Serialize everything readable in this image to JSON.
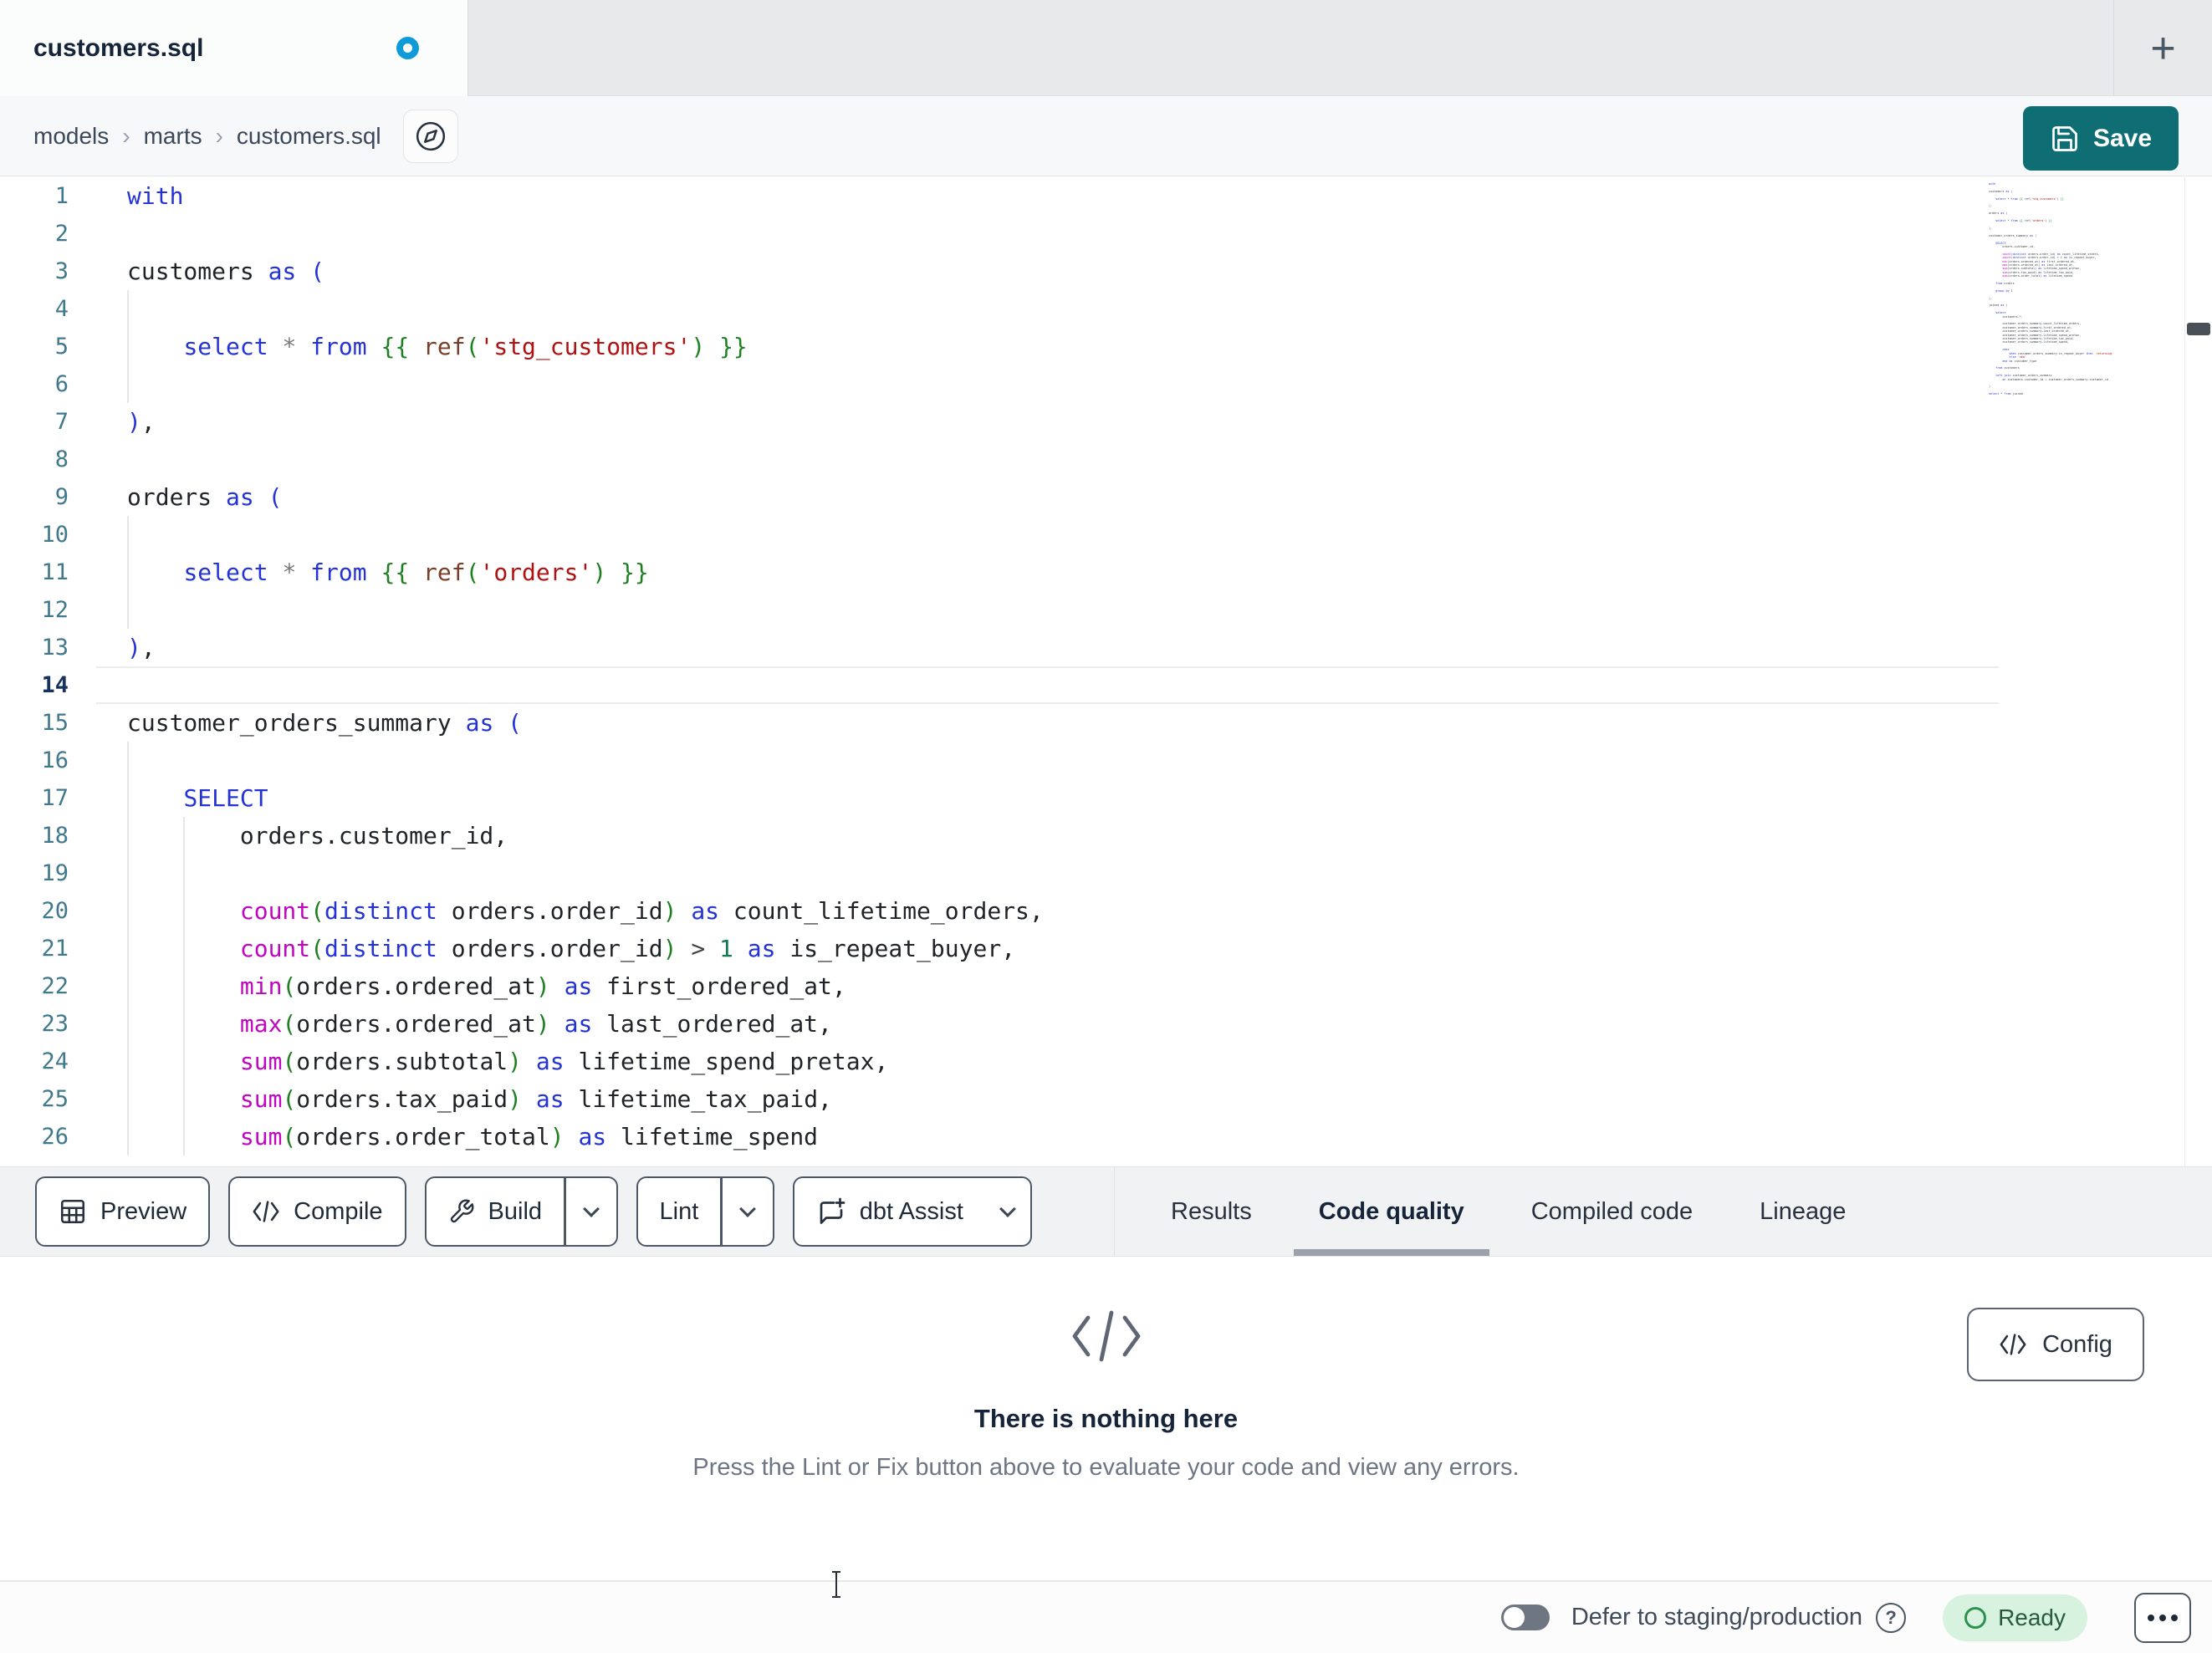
{
  "tab_bar": {
    "active_tab": "customers.sql",
    "new_tab_label": "+"
  },
  "breadcrumb": {
    "items": [
      "models",
      "marts",
      "customers.sql"
    ],
    "separator": "›"
  },
  "save": {
    "label": "Save"
  },
  "editor": {
    "active_line": 14,
    "lines": [
      {
        "n": 1,
        "tokens": [
          [
            "kw",
            "with"
          ]
        ]
      },
      {
        "n": 2,
        "tokens": []
      },
      {
        "n": 3,
        "tokens": [
          [
            "id",
            "customers"
          ],
          [
            "ws",
            " "
          ],
          [
            "kw",
            "as"
          ],
          [
            "ws",
            " "
          ],
          [
            "pb",
            "("
          ]
        ]
      },
      {
        "n": 4,
        "tokens": []
      },
      {
        "n": 5,
        "tokens": [
          [
            "ws",
            "    "
          ],
          [
            "kw",
            "select"
          ],
          [
            "ws",
            " "
          ],
          [
            "gray",
            "*"
          ],
          [
            "ws",
            " "
          ],
          [
            "kw",
            "from"
          ],
          [
            "ws",
            " "
          ],
          [
            "br",
            "{{"
          ],
          [
            "ws",
            " "
          ],
          [
            "ref",
            "ref"
          ],
          [
            "pg",
            "("
          ],
          [
            "str",
            "'stg_customers'"
          ],
          [
            "pg",
            ")"
          ],
          [
            "ws",
            " "
          ],
          [
            "br",
            "}}"
          ]
        ]
      },
      {
        "n": 6,
        "tokens": []
      },
      {
        "n": 7,
        "tokens": [
          [
            "pb",
            ")"
          ],
          [
            "id",
            ","
          ]
        ]
      },
      {
        "n": 8,
        "tokens": []
      },
      {
        "n": 9,
        "tokens": [
          [
            "id",
            "orders"
          ],
          [
            "ws",
            " "
          ],
          [
            "kw",
            "as"
          ],
          [
            "ws",
            " "
          ],
          [
            "pb",
            "("
          ]
        ]
      },
      {
        "n": 10,
        "tokens": []
      },
      {
        "n": 11,
        "tokens": [
          [
            "ws",
            "    "
          ],
          [
            "kw",
            "select"
          ],
          [
            "ws",
            " "
          ],
          [
            "gray",
            "*"
          ],
          [
            "ws",
            " "
          ],
          [
            "kw",
            "from"
          ],
          [
            "ws",
            " "
          ],
          [
            "br",
            "{{"
          ],
          [
            "ws",
            " "
          ],
          [
            "ref",
            "ref"
          ],
          [
            "pg",
            "("
          ],
          [
            "str",
            "'orders'"
          ],
          [
            "pg",
            ")"
          ],
          [
            "ws",
            " "
          ],
          [
            "br",
            "}}"
          ]
        ]
      },
      {
        "n": 12,
        "tokens": []
      },
      {
        "n": 13,
        "tokens": [
          [
            "pb",
            ")"
          ],
          [
            "id",
            ","
          ]
        ]
      },
      {
        "n": 14,
        "tokens": []
      },
      {
        "n": 15,
        "tokens": [
          [
            "id",
            "customer_orders_summary"
          ],
          [
            "ws",
            " "
          ],
          [
            "kw",
            "as"
          ],
          [
            "ws",
            " "
          ],
          [
            "pb",
            "("
          ]
        ]
      },
      {
        "n": 16,
        "tokens": []
      },
      {
        "n": 17,
        "tokens": [
          [
            "ws",
            "    "
          ],
          [
            "kw",
            "SELECT"
          ]
        ]
      },
      {
        "n": 18,
        "tokens": [
          [
            "ws",
            "        "
          ],
          [
            "id",
            "orders.customer_id,"
          ]
        ]
      },
      {
        "n": 19,
        "tokens": []
      },
      {
        "n": 20,
        "tokens": [
          [
            "ws",
            "        "
          ],
          [
            "fn",
            "count"
          ],
          [
            "pg",
            "("
          ],
          [
            "kw",
            "distinct"
          ],
          [
            "ws",
            " "
          ],
          [
            "id",
            "orders.order_id"
          ],
          [
            "pg",
            ")"
          ],
          [
            "ws",
            " "
          ],
          [
            "kw",
            "as"
          ],
          [
            "ws",
            " "
          ],
          [
            "id",
            "count_lifetime_orders,"
          ]
        ]
      },
      {
        "n": 21,
        "tokens": [
          [
            "ws",
            "        "
          ],
          [
            "fn",
            "count"
          ],
          [
            "pg",
            "("
          ],
          [
            "kw",
            "distinct"
          ],
          [
            "ws",
            " "
          ],
          [
            "id",
            "orders.order_id"
          ],
          [
            "pg",
            ")"
          ],
          [
            "ws",
            " "
          ],
          [
            "op",
            ">"
          ],
          [
            "ws",
            " "
          ],
          [
            "num",
            "1"
          ],
          [
            "ws",
            " "
          ],
          [
            "kw",
            "as"
          ],
          [
            "ws",
            " "
          ],
          [
            "id",
            "is_repeat_buyer,"
          ]
        ]
      },
      {
        "n": 22,
        "tokens": [
          [
            "ws",
            "        "
          ],
          [
            "fn",
            "min"
          ],
          [
            "pg",
            "("
          ],
          [
            "id",
            "orders.ordered_at"
          ],
          [
            "pg",
            ")"
          ],
          [
            "ws",
            " "
          ],
          [
            "kw",
            "as"
          ],
          [
            "ws",
            " "
          ],
          [
            "id",
            "first_ordered_at,"
          ]
        ]
      },
      {
        "n": 23,
        "tokens": [
          [
            "ws",
            "        "
          ],
          [
            "fn",
            "max"
          ],
          [
            "pg",
            "("
          ],
          [
            "id",
            "orders.ordered_at"
          ],
          [
            "pg",
            ")"
          ],
          [
            "ws",
            " "
          ],
          [
            "kw",
            "as"
          ],
          [
            "ws",
            " "
          ],
          [
            "id",
            "last_ordered_at,"
          ]
        ]
      },
      {
        "n": 24,
        "tokens": [
          [
            "ws",
            "        "
          ],
          [
            "fn",
            "sum"
          ],
          [
            "pg",
            "("
          ],
          [
            "id",
            "orders.subtotal"
          ],
          [
            "pg",
            ")"
          ],
          [
            "ws",
            " "
          ],
          [
            "kw",
            "as"
          ],
          [
            "ws",
            " "
          ],
          [
            "id",
            "lifetime_spend_pretax,"
          ]
        ]
      },
      {
        "n": 25,
        "tokens": [
          [
            "ws",
            "        "
          ],
          [
            "fn",
            "sum"
          ],
          [
            "pg",
            "("
          ],
          [
            "id",
            "orders.tax_paid"
          ],
          [
            "pg",
            ")"
          ],
          [
            "ws",
            " "
          ],
          [
            "kw",
            "as"
          ],
          [
            "ws",
            " "
          ],
          [
            "id",
            "lifetime_tax_paid,"
          ]
        ]
      },
      {
        "n": 26,
        "tokens": [
          [
            "ws",
            "        "
          ],
          [
            "fn",
            "sum"
          ],
          [
            "pg",
            "("
          ],
          [
            "id",
            "orders.order_total"
          ],
          [
            "pg",
            ")"
          ],
          [
            "ws",
            " "
          ],
          [
            "kw",
            "as"
          ],
          [
            "ws",
            " "
          ],
          [
            "id",
            "lifetime_spend"
          ]
        ]
      }
    ]
  },
  "minimap": {
    "lines": [
      "with",
      "",
      "customers as (",
      "",
      "    select * from {{ ref('stg_customers') }}",
      "",
      "),",
      "",
      "orders as (",
      "",
      "    select * from {{ ref('orders') }}",
      "",
      "),",
      "",
      "customer_orders_summary as (",
      "",
      "    SELECT",
      "        orders.customer_id,",
      "",
      "        count(distinct orders.order_id) as count_lifetime_orders,",
      "        count(distinct orders.order_id) > 1 as is_repeat_buyer,",
      "        min(orders.ordered_at) as first_ordered_at,",
      "        max(orders.ordered_at) as last_ordered_at,",
      "        sum(orders.subtotal) as lifetime_spend_pretax,",
      "        sum(orders.tax_paid) as lifetime_tax_paid,",
      "        sum(orders.order_total) as lifetime_spend",
      "",
      "    from orders",
      "",
      "    group by 1",
      "",
      "),",
      "",
      "joined as (",
      "",
      "    select",
      "        customers.*,",
      "",
      "        customer_orders_summary.count_lifetime_orders,",
      "        customer_orders_summary.first_ordered_at,",
      "        customer_orders_summary.last_ordered_at,",
      "        customer_orders_summary.lifetime_spend_pretax,",
      "        customer_orders_summary.lifetime_tax_paid,",
      "        customer_orders_summary.lifetime_spend,",
      "",
      "        case",
      "            when customer_orders_summary.is_repeat_buyer then 'returning'",
      "            else 'new'",
      "        end as customer_type",
      "",
      "    from customers",
      "",
      "    left join customer_orders_summary",
      "        on customers.customer_id = customer_orders_summary.customer_id",
      "",
      ")",
      "",
      "select * from joined"
    ]
  },
  "toolbar": {
    "buttons": [
      {
        "label": "Preview",
        "icon": "table-icon",
        "split": false,
        "chevron": false
      },
      {
        "label": "Compile",
        "icon": "code-icon",
        "split": false,
        "chevron": false
      },
      {
        "label": "Build",
        "icon": "wrench-icon",
        "split": true,
        "chevron": true
      },
      {
        "label": "Lint",
        "icon": null,
        "split": true,
        "chevron": true
      },
      {
        "label": "dbt Assist",
        "icon": "assist-icon",
        "split": false,
        "chevron": true
      }
    ]
  },
  "panel_tabs": {
    "labels": [
      "Results",
      "Code quality",
      "Compiled code",
      "Lineage"
    ],
    "active_index": 1
  },
  "empty_state": {
    "title": "There is nothing here",
    "subtitle": "Press the Lint or Fix button above to evaluate your code and view any errors."
  },
  "config": {
    "label": "Config"
  },
  "status_bar": {
    "defer_label": "Defer to staging/production",
    "status": "Ready"
  },
  "colors": {
    "accent_teal": "#0e6e73",
    "unsaved_dot_blue": "#0f9bd7",
    "ready_bg": "#d7f2de",
    "ready_text": "#275b3e",
    "ready_ring": "#2d9150",
    "syntax": {
      "keyword": "#2433d6",
      "function": "#bf07bf",
      "paren": "#1e8022",
      "brace": "#1e8022",
      "ref": "#7a3e28",
      "string": "#b01111",
      "number": "#0f7b4f",
      "operator": "#444444",
      "identifier": "#1f2328",
      "star": "#7a7a7a",
      "line_number": "#40798c",
      "active_line_number": "#16335e"
    }
  }
}
